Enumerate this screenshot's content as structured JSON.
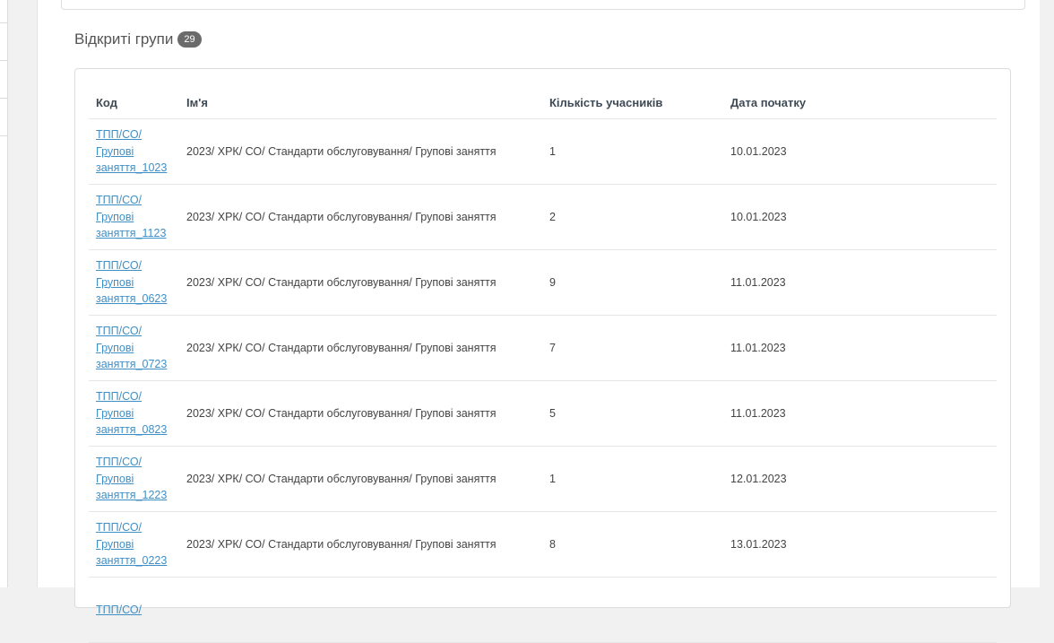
{
  "section": {
    "title": "Відкриті групи",
    "count": "29"
  },
  "table": {
    "headers": {
      "code": "Код",
      "name": "Ім'я",
      "members": "Кількість учасників",
      "start_date": "Дата початку"
    },
    "rows": [
      {
        "code": [
          "ТПП/СО/",
          "Групові",
          "заняття_1023"
        ],
        "name": "2023/ ХРК/ СО/ Стандарти обслуговування/ Групові заняття",
        "members": "1",
        "start_date": "10.01.2023"
      },
      {
        "code": [
          "ТПП/СО/",
          "Групові",
          "заняття_1123"
        ],
        "name": "2023/ ХРК/ СО/ Стандарти обслуговування/ Групові заняття",
        "members": "2",
        "start_date": "10.01.2023"
      },
      {
        "code": [
          "ТПП/СО/",
          "Групові",
          "заняття_0623"
        ],
        "name": "2023/ ХРК/ СО/ Стандарти обслуговування/ Групові заняття",
        "members": "9",
        "start_date": "11.01.2023"
      },
      {
        "code": [
          "ТПП/СО/",
          "Групові",
          "заняття_0723"
        ],
        "name": "2023/ ХРК/ СО/ Стандарти обслуговування/ Групові заняття",
        "members": "7",
        "start_date": "11.01.2023"
      },
      {
        "code": [
          "ТПП/СО/",
          "Групові",
          "заняття_0823"
        ],
        "name": "2023/ ХРК/ СО/ Стандарти обслуговування/ Групові заняття",
        "members": "5",
        "start_date": "11.01.2023"
      },
      {
        "code": [
          "ТПП/СО/",
          "Групові",
          "заняття_1223"
        ],
        "name": "2023/ ХРК/ СО/ Стандарти обслуговування/ Групові заняття",
        "members": "1",
        "start_date": "12.01.2023"
      },
      {
        "code": [
          "ТПП/СО/",
          "Групові",
          "заняття_0223"
        ],
        "name": "2023/ ХРК/ СО/ Стандарти обслуговування/ Групові заняття",
        "members": "8",
        "start_date": "13.01.2023"
      },
      {
        "code": [
          "ТПП/СО/"
        ],
        "name": "",
        "members": "",
        "start_date": ""
      }
    ]
  }
}
